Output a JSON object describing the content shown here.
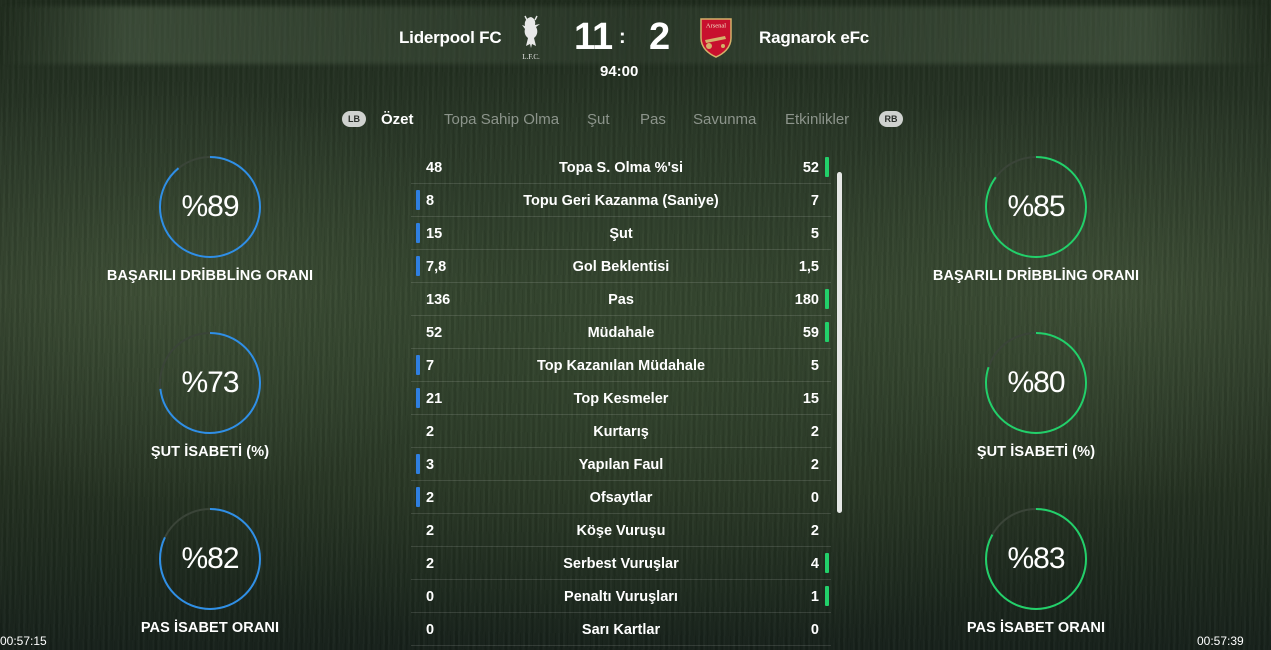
{
  "header": {
    "home_team": "Liderpool FC",
    "away_team": "Ragnarok eFc",
    "home_score": "11",
    "away_score": "2",
    "score_separator": ":",
    "match_clock": "94:00",
    "home_crest_icon": "liverbird-crest-icon",
    "home_crest_text": "L.F.C.",
    "away_crest_icon": "cannon-shield-crest-icon",
    "away_crest_text": "Arsenal"
  },
  "tabs": {
    "left_button": "LB",
    "right_button": "RB",
    "items": [
      "Özet",
      "Topa Sahip Olma",
      "Şut",
      "Pas",
      "Savunma",
      "Etkinlikler"
    ],
    "active": "Özet"
  },
  "colors": {
    "home_accent": "#2f8fe6",
    "away_accent": "#22d06a",
    "ring_track": "#3a4438"
  },
  "home_rings": [
    {
      "value": "%89",
      "percent": 89,
      "label": "BAŞARILI DRİBBLİNG ORANI"
    },
    {
      "value": "%73",
      "percent": 73,
      "label": "ŞUT İSABETİ (%)"
    },
    {
      "value": "%82",
      "percent": 82,
      "label": "PAS İSABET ORANI"
    }
  ],
  "away_rings": [
    {
      "value": "%85",
      "percent": 85,
      "label": "BAŞARILI DRİBBLİNG ORANI"
    },
    {
      "value": "%80",
      "percent": 80,
      "label": "ŞUT İSABETİ (%)"
    },
    {
      "value": "%83",
      "percent": 83,
      "label": "PAS İSABET ORANI"
    }
  ],
  "stats": [
    {
      "home": "48",
      "label": "Topa S. Olma %'si",
      "away": "52",
      "leader": "away"
    },
    {
      "home": "8",
      "label": "Topu Geri Kazanma (Saniye)",
      "away": "7",
      "leader": "home"
    },
    {
      "home": "15",
      "label": "Şut",
      "away": "5",
      "leader": "home"
    },
    {
      "home": "7,8",
      "label": "Gol Beklentisi",
      "away": "1,5",
      "leader": "home"
    },
    {
      "home": "136",
      "label": "Pas",
      "away": "180",
      "leader": "away"
    },
    {
      "home": "52",
      "label": "Müdahale",
      "away": "59",
      "leader": "away"
    },
    {
      "home": "7",
      "label": "Top Kazanılan Müdahale",
      "away": "5",
      "leader": "home"
    },
    {
      "home": "21",
      "label": "Top Kesmeler",
      "away": "15",
      "leader": "home"
    },
    {
      "home": "2",
      "label": "Kurtarış",
      "away": "2",
      "leader": "none"
    },
    {
      "home": "3",
      "label": "Yapılan Faul",
      "away": "2",
      "leader": "home"
    },
    {
      "home": "2",
      "label": "Ofsaytlar",
      "away": "0",
      "leader": "home"
    },
    {
      "home": "2",
      "label": "Köşe Vuruşu",
      "away": "2",
      "leader": "none"
    },
    {
      "home": "2",
      "label": "Serbest Vuruşlar",
      "away": "4",
      "leader": "away"
    },
    {
      "home": "0",
      "label": "Penaltı Vuruşları",
      "away": "1",
      "leader": "away"
    },
    {
      "home": "0",
      "label": "Sarı Kartlar",
      "away": "0",
      "leader": "none"
    }
  ],
  "timestamps": {
    "left": "00:57:15",
    "right": "00:57:39"
  }
}
